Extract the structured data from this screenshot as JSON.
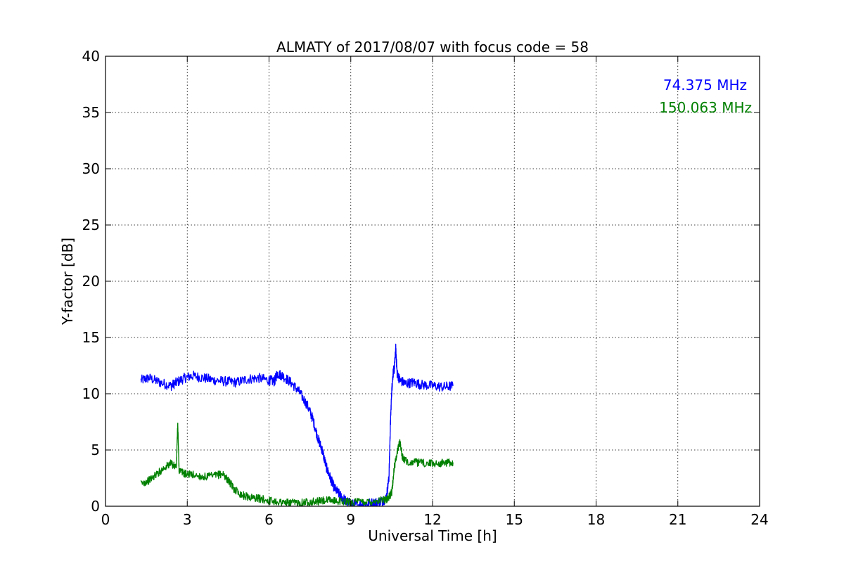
{
  "chart_data": {
    "type": "line",
    "title": "ALMATY of 2017/08/07 with focus code = 58",
    "xlabel": "Universal Time [h]",
    "ylabel": "Y-factor [dB]",
    "xlim": [
      0,
      24
    ],
    "ylim": [
      0,
      40
    ],
    "xticks": [
      0,
      3,
      6,
      9,
      12,
      15,
      18,
      21,
      24
    ],
    "yticks": [
      0,
      5,
      10,
      15,
      20,
      25,
      30,
      35,
      40
    ],
    "grid": true,
    "legend_position": "top-right",
    "series": [
      {
        "name": "74.375 MHz",
        "color": "#0000ff",
        "x": [
          1.3,
          1.6,
          2.0,
          2.4,
          2.6,
          2.9,
          3.2,
          3.6,
          4.0,
          4.4,
          4.8,
          5.2,
          5.6,
          6.0,
          6.2,
          6.3,
          6.5,
          6.8,
          7.1,
          7.4,
          7.6,
          7.8,
          7.95,
          8.1,
          8.25,
          8.4,
          8.6,
          8.8,
          9.0,
          9.2,
          9.5,
          9.8,
          10.1,
          10.3,
          10.4,
          10.45,
          10.5,
          10.55,
          10.6,
          10.65,
          10.7,
          10.8,
          11.0,
          11.3,
          11.6,
          12.0,
          12.4,
          12.75
        ],
        "y": [
          11.2,
          11.4,
          11.0,
          10.7,
          11.0,
          11.4,
          11.6,
          11.4,
          11.2,
          11.1,
          11.0,
          11.3,
          11.4,
          11.2,
          11.1,
          11.8,
          11.6,
          11.0,
          10.2,
          9.0,
          7.8,
          6.0,
          5.0,
          3.5,
          2.5,
          1.6,
          1.0,
          0.5,
          0.2,
          0.1,
          0.2,
          0.3,
          0.4,
          0.7,
          2.5,
          7.0,
          10.2,
          11.8,
          12.3,
          14.0,
          11.8,
          11.2,
          10.9,
          11.0,
          10.8,
          10.7,
          10.6,
          10.7
        ]
      },
      {
        "name": "150.063 MHz",
        "color": "#008000",
        "x": [
          1.3,
          1.6,
          1.9,
          2.2,
          2.4,
          2.6,
          2.65,
          2.7,
          2.9,
          3.2,
          3.6,
          4.0,
          4.3,
          4.5,
          4.7,
          5.0,
          5.3,
          5.6,
          6.0,
          6.4,
          6.6,
          6.8,
          7.1,
          7.4,
          7.7,
          8.0,
          8.4,
          8.8,
          9.2,
          9.6,
          10.0,
          10.3,
          10.4,
          10.5,
          10.6,
          10.7,
          10.8,
          10.9,
          11.0,
          11.4,
          11.8,
          12.2,
          12.5,
          12.75
        ],
        "y": [
          2.0,
          2.3,
          2.9,
          3.5,
          3.8,
          3.5,
          7.4,
          3.2,
          2.9,
          2.8,
          2.6,
          2.7,
          2.9,
          2.3,
          1.6,
          1.0,
          0.8,
          0.7,
          0.5,
          0.4,
          0.3,
          0.3,
          0.3,
          0.4,
          0.4,
          0.5,
          0.5,
          0.4,
          0.4,
          0.4,
          0.5,
          0.6,
          0.8,
          1.2,
          3.5,
          4.8,
          5.8,
          4.3,
          4.0,
          3.9,
          3.8,
          3.8,
          3.9,
          3.9
        ]
      }
    ]
  }
}
